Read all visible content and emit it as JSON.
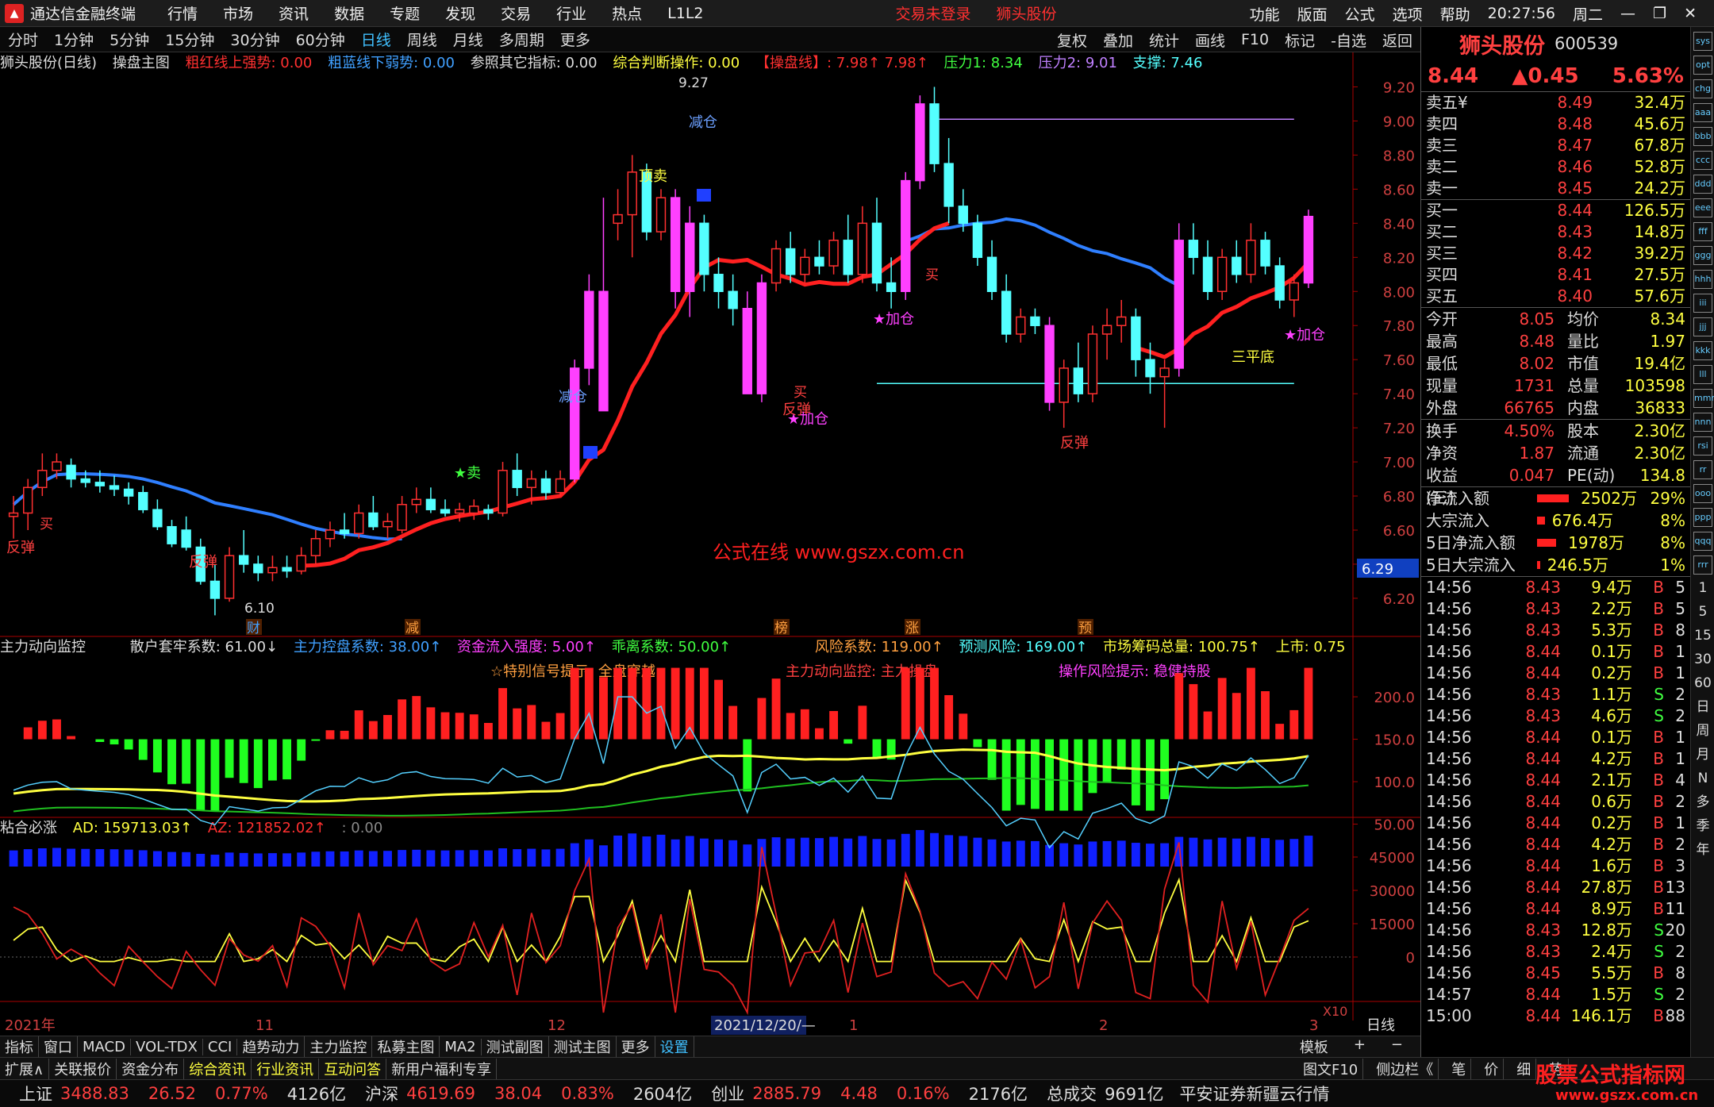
{
  "app": {
    "title": "通达信金融终端",
    "menu": [
      "行情",
      "市场",
      "资讯",
      "数据",
      "专题",
      "发现",
      "交易",
      "行业",
      "热点",
      "L1L2"
    ],
    "login": "交易未登录",
    "stock_link": "狮头股份",
    "right_menu": [
      "功能",
      "版面",
      "公式",
      "选项",
      "帮助"
    ],
    "time": "20:27:56",
    "weekday": "周二"
  },
  "timeframes": [
    "分时",
    "1分钟",
    "5分钟",
    "15分钟",
    "30分钟",
    "60分钟",
    "日线",
    "周线",
    "月线",
    "多周期",
    "更多"
  ],
  "active_timeframe": "日线",
  "tools": [
    "复权",
    "叠加",
    "统计",
    "画线",
    "F10",
    "标记",
    "-自选",
    "返回"
  ],
  "main_info": {
    "name": "狮头股份(日线)",
    "formula": "操盘主图",
    "i1": "粗红线上强势: 0.00",
    "i2": "粗蓝线下弱势: 0.00",
    "i3": "参照其它指标: 0.00",
    "i4": "综合判断操作: 0.00",
    "i5": "【操盘线】: 7.98↑ 7.98↑",
    "i6": "压力1: 8.34",
    "i7": "压力2: 9.01",
    "i8": "支撑: 7.46"
  },
  "main_labels": {
    "max": "9.27",
    "min": "6.10",
    "jiancang": "减仓",
    "dingmai": "顶卖",
    "star_sell": "★卖",
    "mai": "买",
    "fantan": "反弹",
    "fantan2": "反弹",
    "fantan3": "反弹",
    "fantan4": "反弹",
    "jiacang": "★加仓",
    "jiacang2": "★加仓",
    "jiacang3": "★加仓",
    "sanpingdi": "三平底",
    "cur_price": "6.29",
    "watermark": "公式在线 www.gszx.com.cn",
    "jiancang2": "减仓",
    "mai2": "买",
    "mai3": "买"
  },
  "events": [
    "财",
    "减",
    "榜",
    "涨",
    "预"
  ],
  "main_yticks": [
    "9.20",
    "9.00",
    "8.80",
    "8.60",
    "8.40",
    "8.20",
    "8.00",
    "7.80",
    "7.60",
    "7.40",
    "7.20",
    "7.00",
    "6.80",
    "6.60",
    "6.40",
    "6.20"
  ],
  "sub1_info": {
    "name": "主力动向监控",
    "a": "散户套牢系数: 61.00↓",
    "b": "主力控盘系数: 38.00↑",
    "c": "资金流入强度: 5.00↑",
    "d": "乖离系数: 50.00↑",
    "e": "风险系数: 119.00↑",
    "f": "预测风险: 169.00↑",
    "g": "市场筹码总量: 100.75↑",
    "h": "上市: 0.75"
  },
  "sub1_notes": {
    "a": "☆特别信号提示: 全盘穿越",
    "b": "主力动向监控: 主力操盘",
    "c": "操作风险提示: 稳健持股"
  },
  "sub1_yticks": [
    "200.0",
    "150.0",
    "100.0",
    "50.00"
  ],
  "sub2_info": {
    "name": "粘合必涨",
    "ad": "AD: 159713.03↑",
    "az": "AZ: 121852.02↑",
    "z": ": 0.00"
  },
  "sub2_yticks": [
    "45000",
    "30000",
    "15000",
    "0"
  ],
  "sub2_x10": "X10",
  "xaxis": {
    "labels": [
      "2021年",
      "11",
      "12",
      "1",
      "2",
      "3"
    ],
    "cursor": "2021/12/20/—",
    "right": "日线"
  },
  "quote": {
    "name": "狮头股份",
    "code": "600539",
    "price": "8.44",
    "change": "▲0.45",
    "pct": "5.63%"
  },
  "asks": [
    {
      "l": "卖五¥",
      "p": "8.49",
      "v": "32.4万"
    },
    {
      "l": "卖四",
      "p": "8.48",
      "v": "45.6万"
    },
    {
      "l": "卖三",
      "p": "8.47",
      "v": "67.8万"
    },
    {
      "l": "卖二",
      "p": "8.46",
      "v": "52.8万"
    },
    {
      "l": "卖一",
      "p": "8.45",
      "v": "24.2万"
    }
  ],
  "bids": [
    {
      "l": "买一",
      "p": "8.44",
      "v": "126.5万"
    },
    {
      "l": "买二",
      "p": "8.43",
      "v": "14.8万"
    },
    {
      "l": "买三",
      "p": "8.42",
      "v": "39.2万"
    },
    {
      "l": "买四",
      "p": "8.41",
      "v": "27.5万"
    },
    {
      "l": "买五",
      "p": "8.40",
      "v": "57.6万"
    }
  ],
  "stats": [
    {
      "k": "今开",
      "a": "8.05",
      "k2": "均价",
      "b": "8.34"
    },
    {
      "k": "最高",
      "a": "8.48",
      "k2": "量比",
      "b": "1.97"
    },
    {
      "k": "最低",
      "a": "8.02",
      "k2": "市值",
      "b": "19.4亿"
    },
    {
      "k": "现量",
      "a": "1731",
      "k2": "总量",
      "b": "103598"
    },
    {
      "k": "外盘",
      "a": "66765",
      "k2": "内盘",
      "b": "36833"
    }
  ],
  "stats2": [
    {
      "k": "换手",
      "a": "4.50%",
      "k2": "股本",
      "b": "2.30亿"
    },
    {
      "k": "净资",
      "a": "1.87",
      "k2": "流通",
      "b": "2.30亿"
    },
    {
      "k": "收益(三)",
      "a": "0.047",
      "k2": "PE(动)",
      "b": "134.8"
    }
  ],
  "flows": [
    {
      "k": "净流入额",
      "a": "2502万",
      "b": "29%"
    },
    {
      "k": "大宗流入",
      "a": "676.4万",
      "b": "8%"
    },
    {
      "k": "5日净流入额",
      "a": "1978万",
      "b": "8%"
    },
    {
      "k": "5日大宗流入",
      "a": "246.5万",
      "b": "1%"
    }
  ],
  "ticks": [
    {
      "t": "14:56",
      "p": "8.43",
      "v": "9.4万",
      "d": "B",
      "n": "5"
    },
    {
      "t": "14:56",
      "p": "8.43",
      "v": "2.2万",
      "d": "B",
      "n": "5"
    },
    {
      "t": "14:56",
      "p": "8.43",
      "v": "5.3万",
      "d": "B",
      "n": "8"
    },
    {
      "t": "14:56",
      "p": "8.44",
      "v": "0.1万",
      "d": "B",
      "n": "1"
    },
    {
      "t": "14:56",
      "p": "8.44",
      "v": "0.2万",
      "d": "B",
      "n": "1"
    },
    {
      "t": "14:56",
      "p": "8.43",
      "v": "1.1万",
      "d": "S",
      "n": "2"
    },
    {
      "t": "14:56",
      "p": "8.43",
      "v": "4.6万",
      "d": "S",
      "n": "2"
    },
    {
      "t": "14:56",
      "p": "8.44",
      "v": "0.1万",
      "d": "B",
      "n": "1"
    },
    {
      "t": "14:56",
      "p": "8.44",
      "v": "4.2万",
      "d": "B",
      "n": "1"
    },
    {
      "t": "14:56",
      "p": "8.44",
      "v": "2.1万",
      "d": "B",
      "n": "4"
    },
    {
      "t": "14:56",
      "p": "8.44",
      "v": "0.6万",
      "d": "B",
      "n": "2"
    },
    {
      "t": "14:56",
      "p": "8.44",
      "v": "0.2万",
      "d": "B",
      "n": "1"
    },
    {
      "t": "14:56",
      "p": "8.44",
      "v": "4.2万",
      "d": "B",
      "n": "2"
    },
    {
      "t": "14:56",
      "p": "8.44",
      "v": "1.6万",
      "d": "B",
      "n": "3"
    },
    {
      "t": "14:56",
      "p": "8.44",
      "v": "27.8万",
      "d": "B",
      "n": "13"
    },
    {
      "t": "14:56",
      "p": "8.44",
      "v": "8.9万",
      "d": "B",
      "n": "11"
    },
    {
      "t": "14:56",
      "p": "8.43",
      "v": "12.8万",
      "d": "S",
      "n": "20"
    },
    {
      "t": "14:56",
      "p": "8.43",
      "v": "2.4万",
      "d": "S",
      "n": "2"
    },
    {
      "t": "14:56",
      "p": "8.45",
      "v": "5.5万",
      "d": "B",
      "n": "8"
    },
    {
      "t": "14:57",
      "p": "8.44",
      "v": "1.5万",
      "d": "S",
      "n": "2"
    },
    {
      "t": "15:00",
      "p": "8.44",
      "v": "146.1万",
      "d": "B",
      "n": "88"
    }
  ],
  "side_icons": [
    "sys",
    "opt",
    "chg",
    "aaa",
    "bbb",
    "ccc",
    "ddd",
    "eee",
    "fff",
    "ggg",
    "hhh",
    "iii",
    "jjj",
    "kkk",
    "lll",
    "mmm",
    "nnn",
    "rsi",
    "rr",
    "ooo",
    "ppp",
    "qqq",
    "rrr",
    "1",
    "5",
    "15",
    "30",
    "60",
    "日",
    "周",
    "月",
    "N",
    "多",
    "季",
    "年"
  ],
  "tabs1": [
    "指标",
    "窗口",
    "MACD",
    "VOL-TDX",
    "CCI",
    "趋势动力",
    "主力监控",
    "私募主图",
    "MA2",
    "测试副图",
    "测试主图",
    "更多",
    "设置"
  ],
  "tabs1_active": "设置",
  "tabs1_right": [
    "模板",
    "+",
    "−"
  ],
  "tabs2": [
    "扩展∧",
    "关联报价",
    "资金分布",
    "综合资讯",
    "行业资讯",
    "互动问答",
    "新用户福利专享"
  ],
  "tabs2_right": [
    "图文F10",
    "侧边栏《",
    "笔",
    "价",
    "细",
    "势"
  ],
  "status": [
    {
      "n": "上证",
      "v": "3488.83",
      "c": "26.52",
      "p": "0.77%",
      "a": "4126亿"
    },
    {
      "n": "沪深",
      "v": "4619.69",
      "c": "38.04",
      "p": "0.83%",
      "a": "2604亿"
    },
    {
      "n": "创业",
      "v": "2885.79",
      "c": "4.48",
      "p": "0.16%",
      "a": "2176亿"
    }
  ],
  "status_total": {
    "k": "总成交",
    "v": "9691亿"
  },
  "broker": "平安证券新疆云行情",
  "corner_watermark": "股票公式指标网",
  "corner_url": "www.gszx.com.cn",
  "colors": {
    "up": "#ff3030",
    "down": "#54ffff",
    "bluema": "#2f7fff",
    "redma": "#ff2020",
    "yellow": "#ffff40",
    "magenta": "#ff40ff"
  },
  "chart_data": {
    "type": "candlestick",
    "main_ylim": [
      6.1,
      9.27
    ],
    "red_line_last": 7.98,
    "resistance1": 8.34,
    "resistance2": 9.01,
    "support": 7.46,
    "candles": [
      [
        6.68,
        6.8,
        6.55,
        6.7
      ],
      [
        6.7,
        6.9,
        6.6,
        6.85
      ],
      [
        6.85,
        7.05,
        6.8,
        6.95
      ],
      [
        6.95,
        7.05,
        6.9,
        7.0
      ],
      [
        6.98,
        7.02,
        6.85,
        6.9
      ],
      [
        6.9,
        6.95,
        6.85,
        6.88
      ],
      [
        6.88,
        6.95,
        6.82,
        6.86
      ],
      [
        6.86,
        6.92,
        6.8,
        6.84
      ],
      [
        6.84,
        6.88,
        6.75,
        6.8
      ],
      [
        6.82,
        6.86,
        6.7,
        6.72
      ],
      [
        6.72,
        6.78,
        6.6,
        6.62
      ],
      [
        6.62,
        6.66,
        6.5,
        6.52
      ],
      [
        6.6,
        6.68,
        6.48,
        6.5
      ],
      [
        6.5,
        6.55,
        6.28,
        6.3
      ],
      [
        6.3,
        6.4,
        6.1,
        6.2
      ],
      [
        6.2,
        6.5,
        6.18,
        6.45
      ],
      [
        6.45,
        6.6,
        6.35,
        6.4
      ],
      [
        6.4,
        6.45,
        6.3,
        6.35
      ],
      [
        6.35,
        6.45,
        6.3,
        6.38
      ],
      [
        6.38,
        6.45,
        6.32,
        6.36
      ],
      [
        6.36,
        6.5,
        6.34,
        6.45
      ],
      [
        6.45,
        6.6,
        6.4,
        6.55
      ],
      [
        6.55,
        6.65,
        6.5,
        6.6
      ],
      [
        6.6,
        6.7,
        6.55,
        6.58
      ],
      [
        6.58,
        6.75,
        6.55,
        6.7
      ],
      [
        6.7,
        6.8,
        6.6,
        6.62
      ],
      [
        6.62,
        6.7,
        6.55,
        6.65
      ],
      [
        6.6,
        6.8,
        6.58,
        6.75
      ],
      [
        6.75,
        6.85,
        6.7,
        6.78
      ],
      [
        6.78,
        6.85,
        6.7,
        6.72
      ],
      [
        6.72,
        6.78,
        6.68,
        6.7
      ],
      [
        6.7,
        6.76,
        6.65,
        6.72
      ],
      [
        6.7,
        6.78,
        6.66,
        6.74
      ],
      [
        6.72,
        6.75,
        6.66,
        6.7
      ],
      [
        6.7,
        7.0,
        6.68,
        6.95
      ],
      [
        6.95,
        7.05,
        6.8,
        6.85
      ],
      [
        6.85,
        6.95,
        6.75,
        6.9
      ],
      [
        6.9,
        6.95,
        6.78,
        6.82
      ],
      [
        6.82,
        6.95,
        6.8,
        6.9
      ],
      [
        6.9,
        7.6,
        6.88,
        7.55
      ],
      [
        7.55,
        8.1,
        7.45,
        8.0
      ],
      [
        8.0,
        8.55,
        7.3,
        7.3
      ],
      [
        8.4,
        8.6,
        8.3,
        8.45
      ],
      [
        8.45,
        8.8,
        8.2,
        8.7
      ],
      [
        8.7,
        8.75,
        8.3,
        8.35
      ],
      [
        8.35,
        8.6,
        8.3,
        8.55
      ],
      [
        8.55,
        8.6,
        7.9,
        8.0
      ],
      [
        8.0,
        8.5,
        7.85,
        8.4
      ],
      [
        8.4,
        8.45,
        8.0,
        8.1
      ],
      [
        8.1,
        8.2,
        7.9,
        8.0
      ],
      [
        8.0,
        8.1,
        7.8,
        7.9
      ],
      [
        7.9,
        8.0,
        7.4,
        7.4
      ],
      [
        7.4,
        8.1,
        7.35,
        8.05
      ],
      [
        8.05,
        8.3,
        8.0,
        8.25
      ],
      [
        8.25,
        8.35,
        8.05,
        8.1
      ],
      [
        8.1,
        8.25,
        8.05,
        8.2
      ],
      [
        8.2,
        8.3,
        8.1,
        8.15
      ],
      [
        8.15,
        8.35,
        8.1,
        8.3
      ],
      [
        8.3,
        8.45,
        8.05,
        8.1
      ],
      [
        8.1,
        8.5,
        8.05,
        8.4
      ],
      [
        8.4,
        8.55,
        8.0,
        8.05
      ],
      [
        8.05,
        8.2,
        7.9,
        8.0
      ],
      [
        8.0,
        8.7,
        7.95,
        8.65
      ],
      [
        8.65,
        9.15,
        8.6,
        9.1
      ],
      [
        9.1,
        9.2,
        8.7,
        8.75
      ],
      [
        8.75,
        8.9,
        8.4,
        8.5
      ],
      [
        8.5,
        8.6,
        8.35,
        8.4
      ],
      [
        8.4,
        8.45,
        8.15,
        8.2
      ],
      [
        8.2,
        8.3,
        7.95,
        8.0
      ],
      [
        8.0,
        8.1,
        7.7,
        7.75
      ],
      [
        7.75,
        7.9,
        7.7,
        7.85
      ],
      [
        7.85,
        7.9,
        7.75,
        7.8
      ],
      [
        7.8,
        7.85,
        7.3,
        7.35
      ],
      [
        7.35,
        7.6,
        7.2,
        7.55
      ],
      [
        7.55,
        7.7,
        7.35,
        7.4
      ],
      [
        7.4,
        7.8,
        7.35,
        7.75
      ],
      [
        7.75,
        7.9,
        7.6,
        7.8
      ],
      [
        7.8,
        7.95,
        7.7,
        7.85
      ],
      [
        7.85,
        7.9,
        7.5,
        7.6
      ],
      [
        7.6,
        7.7,
        7.4,
        7.5
      ],
      [
        7.5,
        7.6,
        7.2,
        7.55
      ],
      [
        7.55,
        8.4,
        7.5,
        8.3
      ],
      [
        8.3,
        8.4,
        8.1,
        8.2
      ],
      [
        8.2,
        8.3,
        7.95,
        8.0
      ],
      [
        8.0,
        8.25,
        7.95,
        8.2
      ],
      [
        8.2,
        8.3,
        8.05,
        8.1
      ],
      [
        8.1,
        8.4,
        8.05,
        8.3
      ],
      [
        8.3,
        8.35,
        8.1,
        8.15
      ],
      [
        8.15,
        8.2,
        7.9,
        7.95
      ],
      [
        7.95,
        8.1,
        7.85,
        8.05
      ],
      [
        8.05,
        8.48,
        8.02,
        8.44
      ]
    ]
  }
}
